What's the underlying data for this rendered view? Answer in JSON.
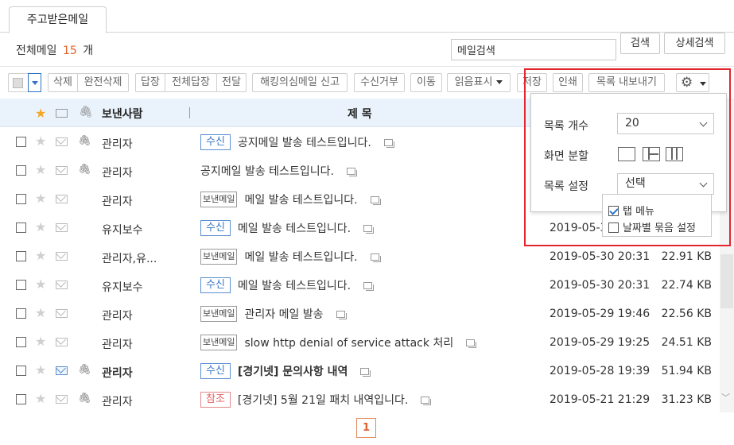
{
  "tab": {
    "label": "주고받은메일"
  },
  "header": {
    "total_prefix": "전체메일",
    "total_count": "15",
    "total_suffix": "개",
    "search_placeholder": "메일검색",
    "search_button": "검색",
    "advanced_search_button": "상세검색"
  },
  "toolbar": {
    "delete": "삭제",
    "delete_permanent": "완전삭제",
    "reply": "답장",
    "reply_all": "전체답장",
    "forward": "전달",
    "report_hacking": "해킹의심메일 신고",
    "reject": "수신거부",
    "move": "이동",
    "mark_read": "읽음표시",
    "save": "저장",
    "print": "인쇄",
    "export": "목록 내보내기"
  },
  "table_header": {
    "sender": "보낸사람",
    "subject": "제 목"
  },
  "rows": [
    {
      "sender": "관리자",
      "badge": "수신",
      "badge_type": "blue",
      "subject": "공지메일 발송 테스트입니다.",
      "date": "",
      "size": "",
      "attach": true,
      "unread": false,
      "bold": false
    },
    {
      "sender": "관리자",
      "badge": "",
      "badge_type": "",
      "subject": "공지메일 발송 테스트입니다.",
      "date": "",
      "size": "",
      "attach": true,
      "unread": false,
      "bold": false
    },
    {
      "sender": "관리자",
      "badge": "보낸메일",
      "badge_type": "gray",
      "subject": "메일 발송 테스트입니다.",
      "date": "",
      "size": "",
      "attach": false,
      "unread": false,
      "bold": false
    },
    {
      "sender": "유지보수",
      "badge": "수신",
      "badge_type": "blue",
      "subject": "메일 발송 테스트입니다.",
      "date": "2019-05-3",
      "size": "",
      "attach": false,
      "unread": false,
      "bold": false
    },
    {
      "sender": "관리자,유...",
      "badge": "보낸메일",
      "badge_type": "gray",
      "subject": "메일 발송 테스트입니다.",
      "date": "2019-05-30 20:31",
      "size": "22.91 KB",
      "attach": false,
      "unread": false,
      "bold": false
    },
    {
      "sender": "유지보수",
      "badge": "수신",
      "badge_type": "blue",
      "subject": "메일 발송 테스트입니다.",
      "date": "2019-05-30 20:31",
      "size": "22.74 KB",
      "attach": false,
      "unread": false,
      "bold": false
    },
    {
      "sender": "관리자",
      "badge": "보낸메일",
      "badge_type": "gray",
      "subject": "관리자 메일 발송",
      "date": "2019-05-29 19:46",
      "size": "22.56 KB",
      "attach": false,
      "unread": false,
      "bold": false
    },
    {
      "sender": "관리자",
      "badge": "보낸메일",
      "badge_type": "gray",
      "subject": "slow http denial of service attack 처리",
      "date": "2019-05-29 19:25",
      "size": "24.51 KB",
      "attach": false,
      "unread": false,
      "bold": false
    },
    {
      "sender": "관리자",
      "badge": "수신",
      "badge_type": "blue",
      "subject": "[경기넷] 문의사항 내역",
      "date": "2019-05-28 19:39",
      "size": "51.94 KB",
      "attach": true,
      "unread": true,
      "bold": true
    },
    {
      "sender": "관리자",
      "badge": "참조",
      "badge_type": "red",
      "subject": "[경기넷] 5월 21일 패치 내역입니다.",
      "date": "2019-05-21 21:29",
      "size": "31.23 KB",
      "attach": true,
      "unread": false,
      "bold": false
    }
  ],
  "pagination": {
    "current": "1"
  },
  "settings_popup": {
    "list_count_label": "목록 개수",
    "list_count_value": "20",
    "split_label": "화면 분할",
    "list_setting_label": "목록 설정",
    "list_setting_value": "선택",
    "options": [
      {
        "label": "탭 메뉴",
        "checked": true
      },
      {
        "label": "날짜별 묶음 설정",
        "checked": false
      }
    ]
  },
  "colors": {
    "accent": "#e0622c",
    "link_blue": "#3a78c3",
    "header_bg": "#eaf3fc",
    "highlight": "#e3262e"
  }
}
